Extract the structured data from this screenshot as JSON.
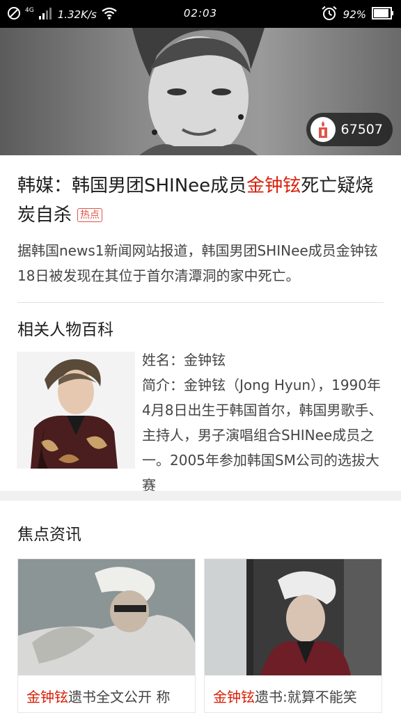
{
  "status_bar": {
    "network": "4G",
    "speed": "1.32K/s",
    "time": "02:03",
    "battery": "92%",
    "icons": [
      "block-icon",
      "signal-icon",
      "wifi-icon",
      "alarm-icon",
      "battery-icon"
    ]
  },
  "hero": {
    "candle_count": "67507",
    "candle_icon": "candle-icon"
  },
  "article": {
    "headline_part1": "韩媒：韩国男团SHINee成员",
    "headline_highlight": "金钟铉",
    "headline_part2": "死亡疑烧炭自杀",
    "hot_tag": "热点",
    "summary": "据韩国news1新闻网站报道，韩国男团SHINee成员金钟铉18日被发现在其位于首尔清潭洞的家中死亡。"
  },
  "person": {
    "section_title": "相关人物百科",
    "name_line": "姓名：金钟铉",
    "bio": "简介：金钟铉（Jong Hyun），1990年4月8日出生于韩国首尔，韩国男歌手、主持人，男子演唱组合SHINee成员之一。2005年参加韩国SM公司的选拔大赛"
  },
  "focus": {
    "section_title": "焦点资讯",
    "cards": [
      {
        "title_highlight": "金钟铉",
        "title_rest": "遗书全文公开 称"
      },
      {
        "title_highlight": "金钟铉",
        "title_rest": "遗书:就算不能笑"
      }
    ]
  },
  "colors": {
    "highlight": "#d81e06",
    "tag": "#e0544a",
    "text": "#1d1d1d",
    "muted": "#444444"
  }
}
